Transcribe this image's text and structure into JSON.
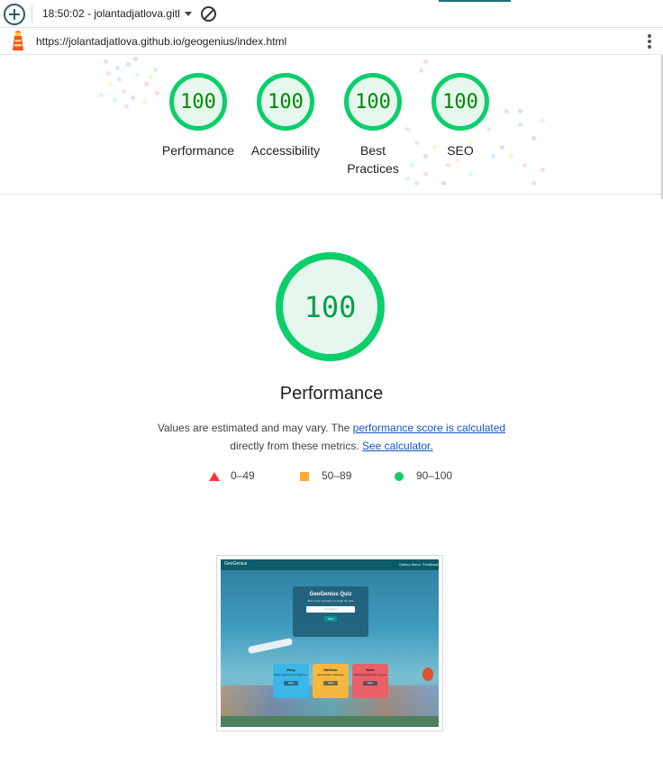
{
  "toolbar": {
    "report_select": "18:50:02 - jolantadjatlova.gitl",
    "icons": [
      "add-icon",
      "chevron-down-icon",
      "block-icon"
    ]
  },
  "urlbar": {
    "url": "https://jolantadjatlova.github.io/geogenius/index.html",
    "icons": [
      "lighthouse-logo-icon",
      "more-vert-icon"
    ]
  },
  "summary": {
    "gauges": [
      {
        "score": "100",
        "label": "Performance"
      },
      {
        "score": "100",
        "label": "Accessibility"
      },
      {
        "score": "100",
        "label": "Best Practices"
      },
      {
        "score": "100",
        "label": "SEO"
      }
    ]
  },
  "performance": {
    "score": "100",
    "title": "Performance",
    "desc_prefix": "Values are estimated and may vary. The ",
    "desc_link1": "performance score is calculated",
    "desc_middle": "directly from these metrics.",
    "desc_link2": "See calculator.",
    "legend": [
      {
        "range": "0–49",
        "color": "#ff3333",
        "shape": "triangle"
      },
      {
        "range": "50–89",
        "color": "#ffaa33",
        "shape": "square"
      },
      {
        "range": "90–100",
        "color": "#0cce6b",
        "shape": "circle"
      }
    ]
  },
  "thumbnail": {
    "brand": "GeoGenius",
    "nav_1": "Gallery Menu",
    "nav_2": "Feedback",
    "card_title": "GeoGenius Quiz",
    "card_sub": "Enter your username to begin the quiz",
    "input_placeholder": "Your Name",
    "start": "Start",
    "levels": [
      {
        "name": "Easy",
        "desc": "Basic questions for beginners",
        "btn": "Start",
        "color": "#3cb6e8"
      },
      {
        "name": "Medium",
        "desc": "Intermediate challenges",
        "btn": "Start",
        "color": "#f4b740"
      },
      {
        "name": "Hard",
        "desc": "Difficult questions for experts",
        "btn": "Start",
        "color": "#e86068"
      }
    ]
  },
  "colors": {
    "pass": "#0cce6b",
    "pass_text": "#008800",
    "link": "#1155cc"
  }
}
